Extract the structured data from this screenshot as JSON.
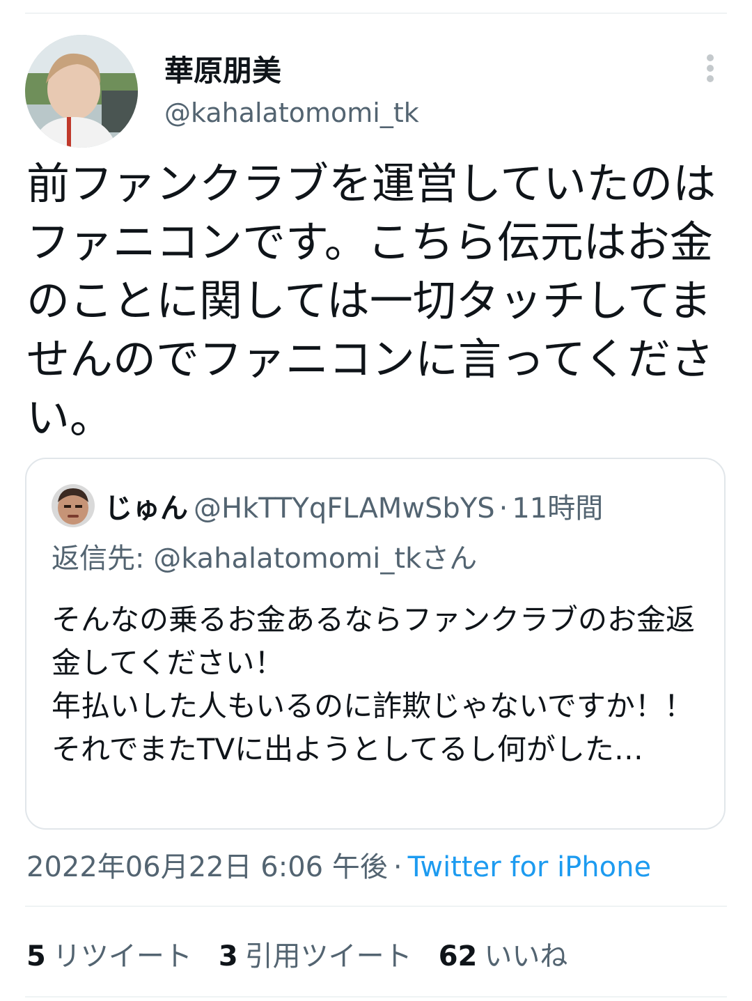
{
  "author": {
    "display_name": "華原朋美",
    "handle": "@kahalatomomi_tk",
    "avatar_icon": "user-avatar-photo"
  },
  "tweet": {
    "text": "前ファンクラブを運営していたのはファニコンです。こちら伝元はお金のことに関しては一切タッチしてませんのでファニコンに言ってください。"
  },
  "quoted_tweet": {
    "display_name": "じゅん",
    "handle": "@HkTTYqFLAMwSbYS",
    "separator": "·",
    "time": "11時間",
    "reply_to": "返信先: @kahalatomomi_tkさん",
    "text": "そんなの乗るお金あるならファンクラブのお金返金してください！\n年払いした人もいるのに詐欺じゃないですか！！\nそれでまたTVに出ようとしてるし何がした…"
  },
  "meta": {
    "date": "2022年06月22日 6:06 午後",
    "separator": "·",
    "source": "Twitter for iPhone"
  },
  "stats": {
    "retweets_count": "5",
    "retweets_label": "リツイート",
    "quotes_count": "3",
    "quotes_label": "引用ツイート",
    "likes_count": "62",
    "likes_label": "いいね"
  },
  "colors": {
    "text_primary": "#0f1419",
    "text_secondary": "#536471",
    "link": "#1d9bf0",
    "border": "#e1e6ea"
  }
}
